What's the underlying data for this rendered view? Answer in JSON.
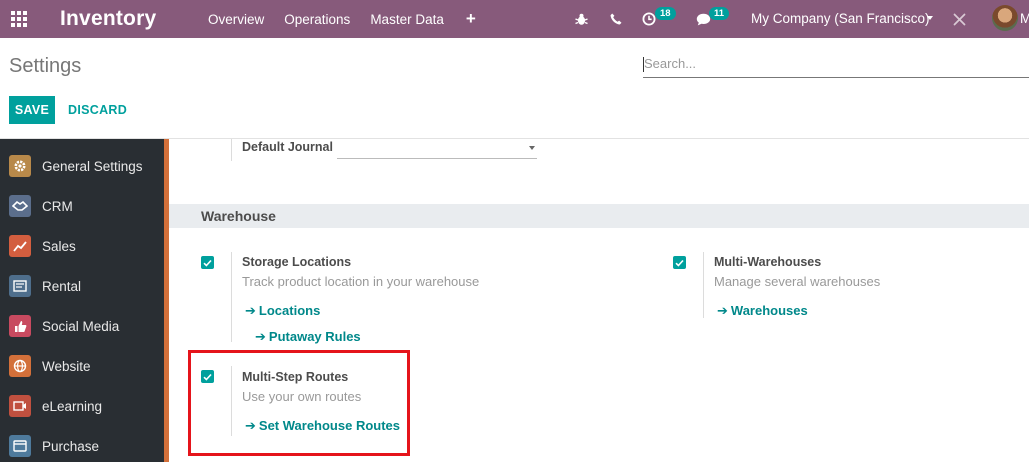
{
  "navbar": {
    "brand": "Inventory",
    "menu": [
      "Overview",
      "Operations",
      "Master Data"
    ],
    "plus": "+",
    "activity_count": "18",
    "message_count": "11",
    "company": "My Company (San Francisco)",
    "user_initial": "M"
  },
  "control_panel": {
    "title": "Settings",
    "search_placeholder": "Search...",
    "save_label": "SAVE",
    "discard_label": "DISCARD"
  },
  "sidebar": {
    "items": [
      {
        "label": "General Settings",
        "icon": "gear-icon",
        "color": "#b8894a"
      },
      {
        "label": "CRM",
        "icon": "handshake-icon",
        "color": "#5b6e8c"
      },
      {
        "label": "Sales",
        "icon": "chart-icon",
        "color": "#d35e3f"
      },
      {
        "label": "Rental",
        "icon": "rental-icon",
        "color": "#4e6e8c"
      },
      {
        "label": "Social Media",
        "icon": "thumbs-up-icon",
        "color": "#c84a60"
      },
      {
        "label": "Website",
        "icon": "globe-icon",
        "color": "#d3703a"
      },
      {
        "label": "eLearning",
        "icon": "elearning-icon",
        "color": "#c0503f"
      },
      {
        "label": "Purchase",
        "icon": "purchase-icon",
        "color": "#4e7a9c"
      }
    ]
  },
  "content": {
    "default_journal_label": "Default Journal",
    "section_title": "Warehouse",
    "settings": {
      "storage_locations": {
        "title": "Storage Locations",
        "description": "Track product location in your warehouse",
        "links": [
          "Locations",
          "Putaway Rules"
        ],
        "checked": true
      },
      "multi_warehouses": {
        "title": "Multi-Warehouses",
        "description": "Manage several warehouses",
        "links": [
          "Warehouses"
        ],
        "checked": true
      },
      "multi_step_routes": {
        "title": "Multi-Step Routes",
        "description": "Use your own routes",
        "links": [
          "Set Warehouse Routes"
        ],
        "checked": true
      }
    }
  },
  "colors": {
    "navbar": "#875a7b",
    "accent": "#00a09d",
    "link": "#00888a",
    "highlight": "#e5141b",
    "sidebar": "#292e33"
  }
}
